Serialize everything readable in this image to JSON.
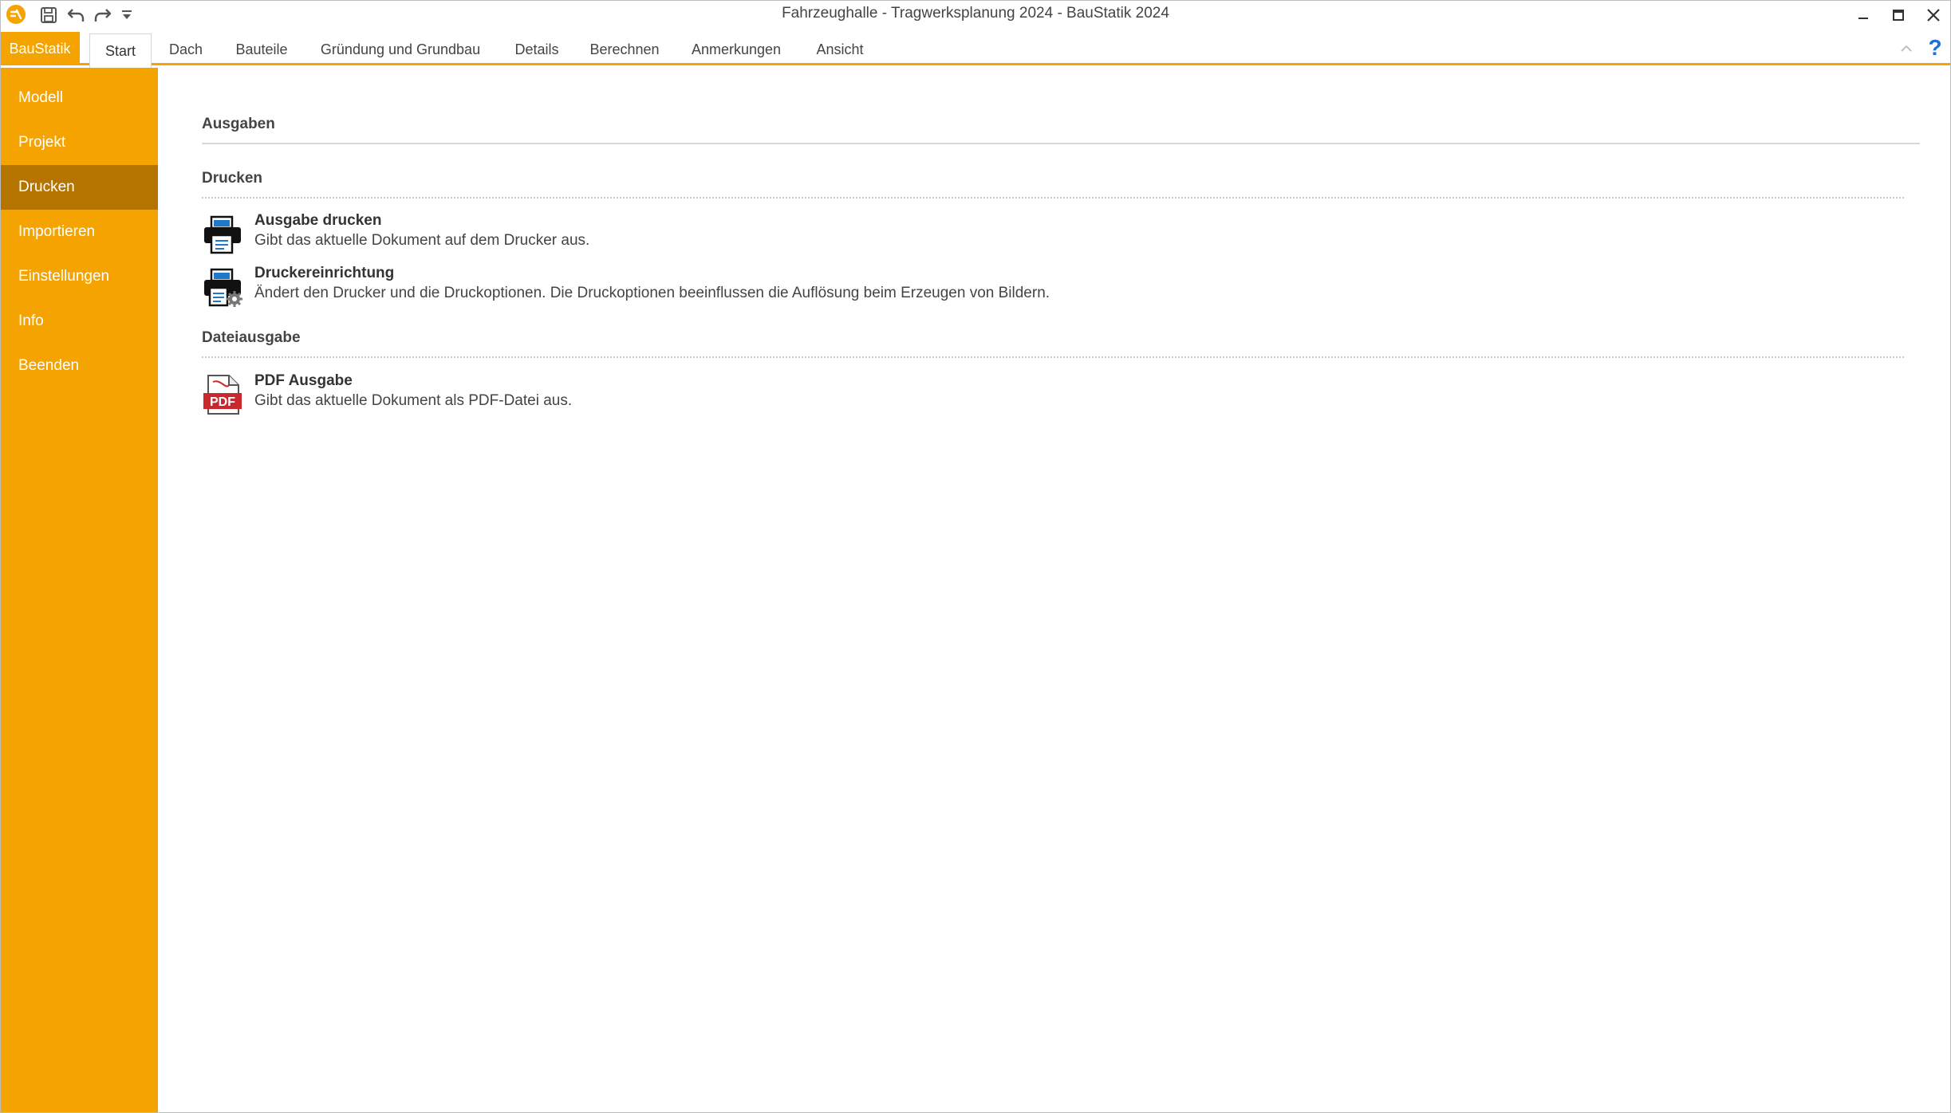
{
  "window": {
    "title": "Fahrzeughalle - Tragwerksplanung 2024 - BauStatik 2024"
  },
  "quick_access": {
    "icons": [
      "app-logo-icon",
      "save-icon",
      "undo-icon",
      "redo-icon",
      "customize-dropdown-icon"
    ]
  },
  "ribbon": {
    "file_tab": "BauStatik",
    "tabs": [
      {
        "label": "Start"
      },
      {
        "label": "Dach"
      },
      {
        "label": "Bauteile"
      },
      {
        "label": "Gründung und Grundbau"
      },
      {
        "label": "Details"
      },
      {
        "label": "Berechnen"
      },
      {
        "label": "Anmerkungen"
      },
      {
        "label": "Ansicht"
      }
    ],
    "active_tab": "Start",
    "help": "?"
  },
  "sidebar": {
    "items": [
      {
        "label": "Modell"
      },
      {
        "label": "Projekt"
      },
      {
        "label": "Drucken"
      },
      {
        "label": "Importieren"
      },
      {
        "label": "Einstellungen"
      },
      {
        "label": "Info"
      },
      {
        "label": "Beenden"
      }
    ],
    "active_item": "Drucken"
  },
  "main": {
    "title": "Ausgaben",
    "groups": [
      {
        "title": "Drucken",
        "commands": [
          {
            "title": "Ausgabe drucken",
            "description": "Gibt das aktuelle Dokument auf dem Drucker aus.",
            "icon": "printer-icon"
          },
          {
            "title": "Druckereinrichtung",
            "description": "Ändert den Drucker und die Druckoptionen. Die Druckoptionen beeinflussen die Auflösung beim Erzeugen von Bildern.",
            "icon": "printer-settings-icon"
          }
        ]
      },
      {
        "title": "Dateiausgabe",
        "commands": [
          {
            "title": "PDF Ausgabe",
            "description": "Gibt das aktuelle Dokument als PDF-Datei aus.",
            "icon": "pdf-icon",
            "icon_text": "PDF"
          }
        ]
      }
    ]
  },
  "colors": {
    "accent": "#f5a300",
    "sidebar_active": "#b57400",
    "help_blue": "#1e6fd9",
    "pdf_red": "#c8282e",
    "printer_blue": "#1f78c8"
  }
}
